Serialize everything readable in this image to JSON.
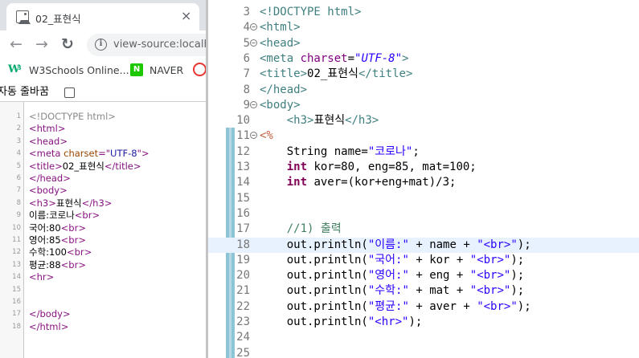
{
  "browser": {
    "tab_title": "02_표현식",
    "tab_close": "×",
    "nav": {
      "back": "←",
      "forward": "→",
      "reload": "↻"
    },
    "url": "view-source:localh",
    "info_symbol": "i",
    "bookmarks": [
      {
        "label": "W3Schools Online...",
        "icon": "w3schools-icon"
      },
      {
        "label": "NAVER",
        "icon": "naver-icon",
        "icon_text": "N"
      },
      {
        "label": "",
        "icon": "red-circle-icon"
      }
    ],
    "w3_letter": "W",
    "line_wrap_label": "자동 줄바꿈",
    "source_lines": [
      {
        "num": "1",
        "parts": [
          [
            "c-com",
            "<!DOCTYPE html>"
          ]
        ]
      },
      {
        "num": "2",
        "parts": [
          [
            "c-tag",
            "<html>"
          ]
        ]
      },
      {
        "num": "3",
        "parts": [
          [
            "c-tag",
            "<head>"
          ]
        ]
      },
      {
        "num": "4",
        "parts": [
          [
            "c-tag",
            "<meta "
          ],
          [
            "c-attr",
            "charset"
          ],
          [
            "c-tag",
            "=\""
          ],
          [
            "c-val",
            "UTF-8"
          ],
          [
            "c-tag",
            "\">"
          ]
        ]
      },
      {
        "num": "5",
        "parts": [
          [
            "c-tag",
            "<title>"
          ],
          [
            "c-txt",
            "02_표현식"
          ],
          [
            "c-tag",
            "</title>"
          ]
        ]
      },
      {
        "num": "6",
        "parts": [
          [
            "c-tag",
            "</head>"
          ]
        ]
      },
      {
        "num": "7",
        "parts": [
          [
            "c-tag",
            "<body>"
          ]
        ]
      },
      {
        "num": "8",
        "parts": [
          [
            "c-txt",
            "     "
          ],
          [
            "c-tag",
            "<h3>"
          ],
          [
            "c-txt",
            "표현식"
          ],
          [
            "c-tag",
            "</h3>"
          ]
        ]
      },
      {
        "num": "9",
        "parts": [
          [
            "c-txt",
            "이름:코로나"
          ],
          [
            "c-tag",
            "<br>"
          ]
        ]
      },
      {
        "num": "10",
        "parts": [
          [
            "c-txt",
            "국어:80"
          ],
          [
            "c-tag",
            "<br>"
          ]
        ]
      },
      {
        "num": "11",
        "parts": [
          [
            "c-txt",
            "영어:85"
          ],
          [
            "c-tag",
            "<br>"
          ]
        ]
      },
      {
        "num": "12",
        "parts": [
          [
            "c-txt",
            "수학:100"
          ],
          [
            "c-tag",
            "<br>"
          ]
        ]
      },
      {
        "num": "13",
        "parts": [
          [
            "c-txt",
            "평균:88"
          ],
          [
            "c-tag",
            "<br>"
          ]
        ]
      },
      {
        "num": "14",
        "parts": [
          [
            "c-tag",
            "<hr>"
          ]
        ]
      },
      {
        "num": "15",
        "parts": []
      },
      {
        "num": "16",
        "parts": []
      },
      {
        "num": "17",
        "parts": [
          [
            "c-tag",
            "</body>"
          ]
        ]
      },
      {
        "num": "18",
        "parts": [
          [
            "c-tag",
            "</html>"
          ]
        ]
      }
    ]
  },
  "editor": {
    "fold_symbol": "⊖",
    "current_line": "18",
    "lines": [
      {
        "num": "3",
        "fold": false,
        "parts": [
          [
            "k-tag",
            "<!DOCTYPE html>"
          ]
        ]
      },
      {
        "num": "4",
        "fold": true,
        "parts": [
          [
            "k-tag",
            "<html>"
          ]
        ]
      },
      {
        "num": "5",
        "fold": true,
        "parts": [
          [
            "k-tag",
            "<head>"
          ]
        ]
      },
      {
        "num": "6",
        "fold": false,
        "parts": [
          [
            "k-tag",
            "<meta "
          ],
          [
            "k-attr",
            "charset"
          ],
          [
            "k-plain",
            "="
          ],
          [
            "k-str",
            "\"UTF-8\""
          ],
          [
            "k-tag",
            ">"
          ]
        ]
      },
      {
        "num": "7",
        "fold": false,
        "parts": [
          [
            "k-tag",
            "<title>"
          ],
          [
            "k-plain",
            "02_표현식"
          ],
          [
            "k-tag",
            "</title>"
          ]
        ]
      },
      {
        "num": "8",
        "fold": false,
        "parts": [
          [
            "k-tag",
            "</head>"
          ]
        ]
      },
      {
        "num": "9",
        "fold": true,
        "parts": [
          [
            "k-tag",
            "<body>"
          ]
        ]
      },
      {
        "num": "10",
        "fold": false,
        "parts": [
          [
            "k-plain",
            "    "
          ],
          [
            "k-tag",
            "<h3>"
          ],
          [
            "k-plain",
            "표현식"
          ],
          [
            "k-tag",
            "</h3>"
          ]
        ]
      },
      {
        "num": "11",
        "fold": true,
        "parts": [
          [
            "k-jsp",
            "<%"
          ]
        ]
      },
      {
        "num": "12",
        "fold": false,
        "parts": [
          [
            "k-plain",
            "    String name="
          ],
          [
            "k-jstr",
            "\"코로나\""
          ],
          [
            "k-plain",
            ";"
          ]
        ]
      },
      {
        "num": "13",
        "fold": false,
        "parts": [
          [
            "k-plain",
            "    "
          ],
          [
            "k-kw",
            "int"
          ],
          [
            "k-plain",
            " kor=80, eng=85, mat=100;"
          ]
        ]
      },
      {
        "num": "14",
        "fold": false,
        "parts": [
          [
            "k-plain",
            "    "
          ],
          [
            "k-kw",
            "int"
          ],
          [
            "k-plain",
            " aver=(kor+eng+mat)/3;"
          ]
        ]
      },
      {
        "num": "15",
        "fold": false,
        "parts": []
      },
      {
        "num": "16",
        "fold": false,
        "parts": []
      },
      {
        "num": "17",
        "fold": false,
        "parts": [
          [
            "k-plain",
            "    "
          ],
          [
            "k-com",
            "//1) 출력"
          ]
        ]
      },
      {
        "num": "18",
        "fold": false,
        "parts": [
          [
            "k-plain",
            "    out.println("
          ],
          [
            "k-jstr",
            "\"이름:\""
          ],
          [
            "k-plain",
            " + name + "
          ],
          [
            "k-jstr",
            "\"<br>\""
          ],
          [
            "k-plain",
            ");"
          ]
        ]
      },
      {
        "num": "19",
        "fold": false,
        "parts": [
          [
            "k-plain",
            "    out.println("
          ],
          [
            "k-jstr",
            "\"국어:\""
          ],
          [
            "k-plain",
            " + kor + "
          ],
          [
            "k-jstr",
            "\"<br>\""
          ],
          [
            "k-plain",
            ");"
          ]
        ]
      },
      {
        "num": "20",
        "fold": false,
        "parts": [
          [
            "k-plain",
            "    out.println("
          ],
          [
            "k-jstr",
            "\"영어:\""
          ],
          [
            "k-plain",
            " + eng + "
          ],
          [
            "k-jstr",
            "\"<br>\""
          ],
          [
            "k-plain",
            ");"
          ]
        ]
      },
      {
        "num": "21",
        "fold": false,
        "parts": [
          [
            "k-plain",
            "    out.println("
          ],
          [
            "k-jstr",
            "\"수학:\""
          ],
          [
            "k-plain",
            " + mat + "
          ],
          [
            "k-jstr",
            "\"<br>\""
          ],
          [
            "k-plain",
            ");"
          ]
        ]
      },
      {
        "num": "22",
        "fold": false,
        "parts": [
          [
            "k-plain",
            "    out.println("
          ],
          [
            "k-jstr",
            "\"평균:\""
          ],
          [
            "k-plain",
            " + aver + "
          ],
          [
            "k-jstr",
            "\"<br>\""
          ],
          [
            "k-plain",
            ");"
          ]
        ]
      },
      {
        "num": "23",
        "fold": false,
        "parts": [
          [
            "k-plain",
            "    out.println("
          ],
          [
            "k-jstr",
            "\"<hr>\""
          ],
          [
            "k-plain",
            ");"
          ]
        ]
      },
      {
        "num": "24",
        "fold": false,
        "parts": []
      },
      {
        "num": "25",
        "fold": false,
        "parts": []
      }
    ]
  }
}
